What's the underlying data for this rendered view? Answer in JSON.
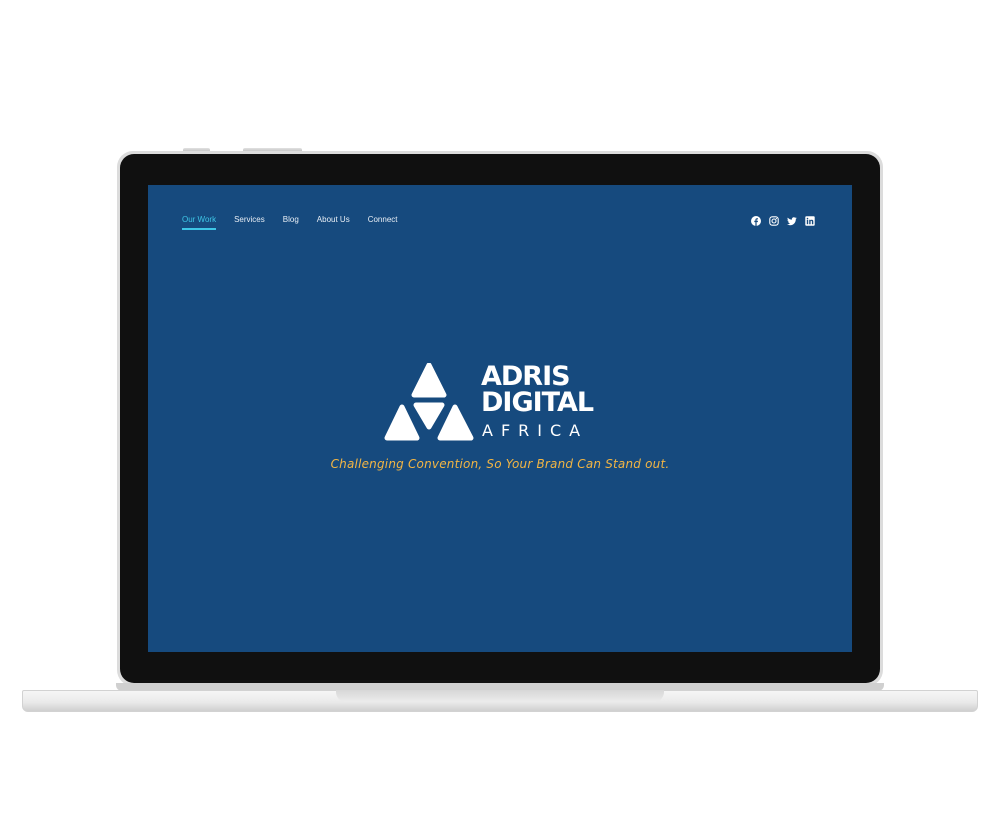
{
  "nav": {
    "items": [
      {
        "label": "Our Work",
        "active": true
      },
      {
        "label": "Services",
        "active": false
      },
      {
        "label": "Blog",
        "active": false
      },
      {
        "label": "About Us",
        "active": false
      },
      {
        "label": "Connect",
        "active": false
      }
    ]
  },
  "social": {
    "icons": [
      "facebook-icon",
      "instagram-icon",
      "twitter-icon",
      "linkedin-icon"
    ]
  },
  "hero": {
    "logo_line1": "ADRIS",
    "logo_line2": "DIGITAL",
    "logo_line3": "AFRICA",
    "tagline": "Challenging Convention, So Your Brand Can Stand out."
  },
  "colors": {
    "background": "#164a7e",
    "accent": "#3ec6e6",
    "tagline": "#f2b544",
    "text": "#ffffff"
  }
}
